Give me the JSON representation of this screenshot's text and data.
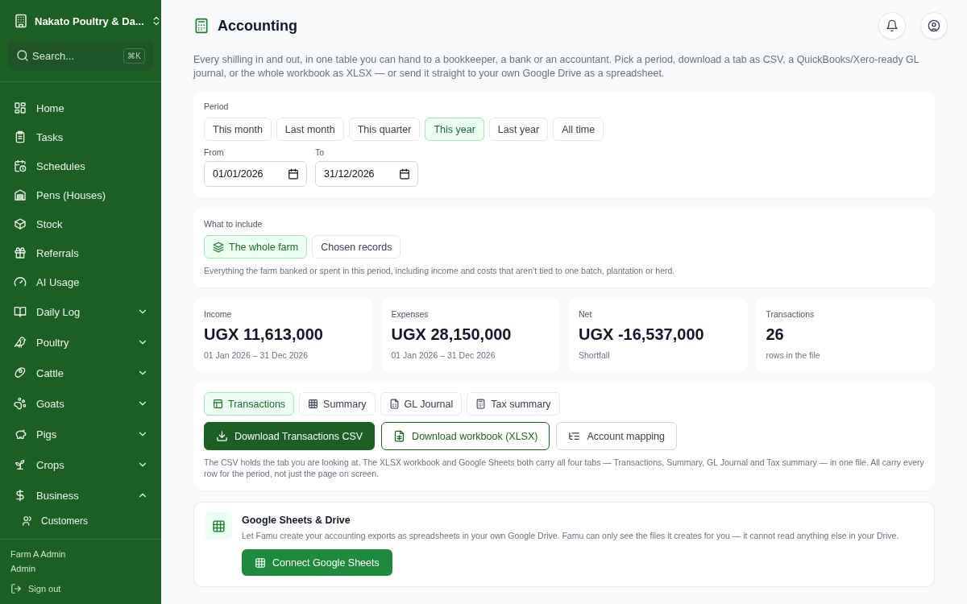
{
  "sidebar": {
    "farm": "Nakato Poultry & Da...",
    "search": {
      "placeholder": "Search...",
      "shortcut": "⌘K"
    },
    "items": [
      {
        "label": "Home",
        "kind": "link"
      },
      {
        "label": "Tasks",
        "kind": "link"
      },
      {
        "label": "Schedules",
        "kind": "link"
      },
      {
        "label": "Pens (Houses)",
        "kind": "link"
      },
      {
        "label": "Stock",
        "kind": "link"
      },
      {
        "label": "Referrals",
        "kind": "link"
      },
      {
        "label": "AI Usage",
        "kind": "link"
      },
      {
        "label": "Daily Log",
        "kind": "group",
        "expanded": false
      },
      {
        "label": "Poultry",
        "kind": "group",
        "expanded": false
      },
      {
        "label": "Cattle",
        "kind": "group",
        "expanded": false
      },
      {
        "label": "Goats",
        "kind": "group",
        "expanded": false
      },
      {
        "label": "Pigs",
        "kind": "group",
        "expanded": false
      },
      {
        "label": "Crops",
        "kind": "group",
        "expanded": false
      },
      {
        "label": "Business",
        "kind": "group",
        "expanded": true,
        "children": [
          {
            "label": "Customers"
          }
        ]
      }
    ],
    "user": {
      "name": "Farm A Admin",
      "role": "Admin",
      "sign_out": "Sign out"
    }
  },
  "page": {
    "title": "Accounting",
    "intro": "Every shilling in and out, in one table you can hand to a bookkeeper, a bank or an accountant. Pick a period, download a tab as CSV, a QuickBooks/Xero-ready GL journal, or the whole workbook as XLSX — or send it straight to your own Google Drive as a spreadsheet."
  },
  "period": {
    "label": "Period",
    "options": [
      {
        "label": "This month",
        "selected": false
      },
      {
        "label": "Last month",
        "selected": false
      },
      {
        "label": "This quarter",
        "selected": false
      },
      {
        "label": "This year",
        "selected": true
      },
      {
        "label": "Last year",
        "selected": false
      },
      {
        "label": "All time",
        "selected": false
      }
    ],
    "from": {
      "label": "From",
      "value": "01/01/2026"
    },
    "to": {
      "label": "To",
      "value": "31/12/2026"
    }
  },
  "include": {
    "label": "What to include",
    "options": [
      {
        "label": "The whole farm",
        "selected": true
      },
      {
        "label": "Chosen records",
        "selected": false
      }
    ],
    "note": "Everything the farm banked or spent in this period, including income and costs that aren’t tied to one batch, plantation or herd."
  },
  "stats": [
    {
      "label": "Income",
      "value": "UGX 11,613,000",
      "sub": "01 Jan 2026 – 31 Dec 2026"
    },
    {
      "label": "Expenses",
      "value": "UGX 28,150,000",
      "sub": "01 Jan 2026 – 31 Dec 2026"
    },
    {
      "label": "Net",
      "value": "UGX -16,537,000",
      "sub": "Shortfall"
    },
    {
      "label": "Transactions",
      "value": "26",
      "sub": "rows in the file"
    }
  ],
  "export": {
    "tabs": [
      {
        "label": "Transactions",
        "selected": true
      },
      {
        "label": "Summary",
        "selected": false
      },
      {
        "label": "GL Journal",
        "selected": false
      },
      {
        "label": "Tax summary",
        "selected": false
      }
    ],
    "buttons": [
      {
        "label": "Download Transactions CSV",
        "kind": "primary"
      },
      {
        "label": "Download workbook (XLSX)",
        "kind": "outline"
      },
      {
        "label": "Account mapping",
        "kind": "plain"
      }
    ],
    "note": "The CSV holds the tab you are looking at. The XLSX workbook and Google Sheets both carry all four tabs — Transactions, Summary, GL Journal and Tax summary — in one file. All carry every row for the period, not just the page on screen."
  },
  "google": {
    "title": "Google Sheets & Drive",
    "text": "Let Famu create your accounting exports as spreadsheets in your own Google Drive. Famu can only see the files it creates for you — it cannot read anything else in your Drive.",
    "button": "Connect Google Sheets"
  }
}
